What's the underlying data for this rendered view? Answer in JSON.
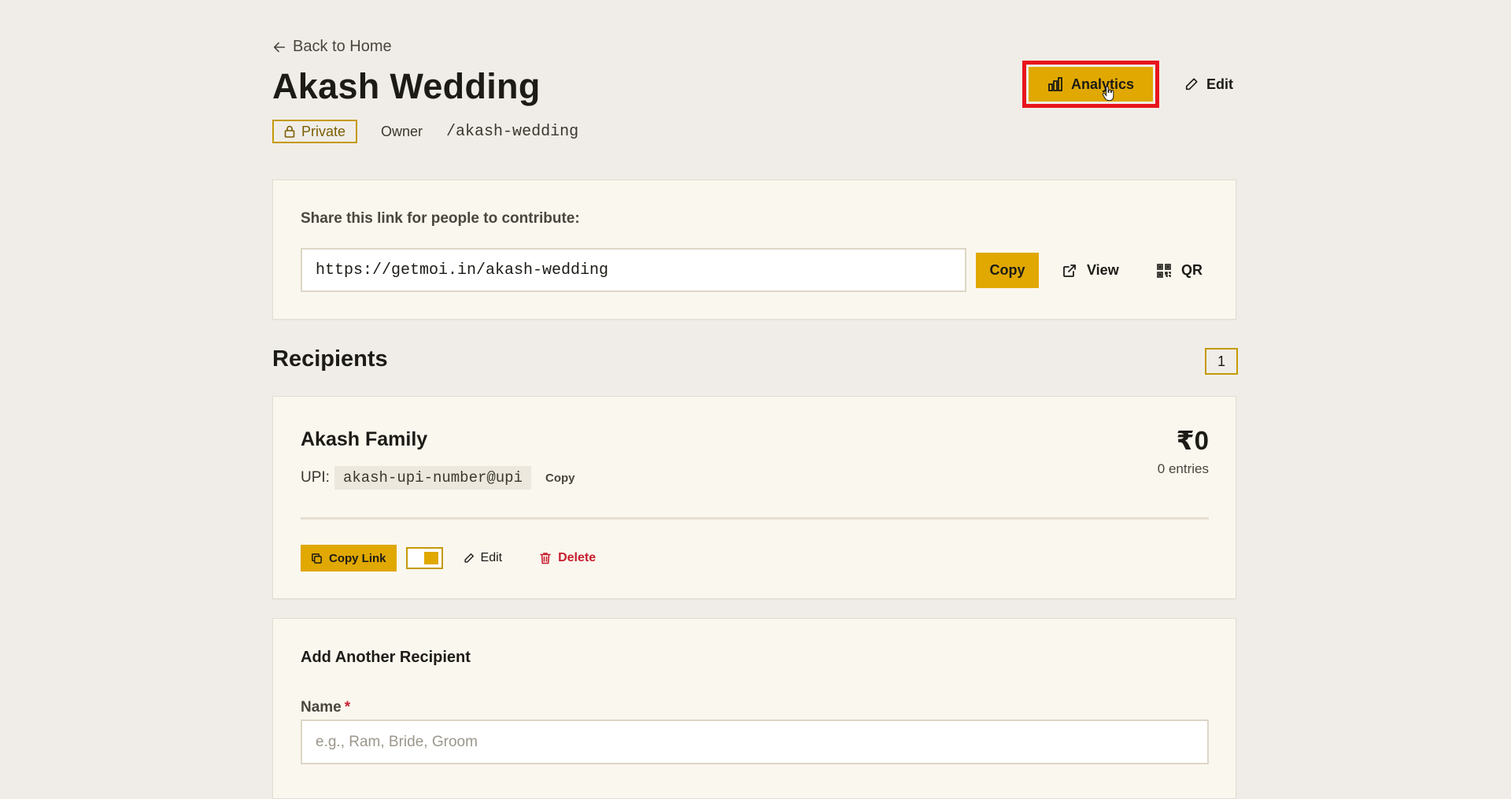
{
  "nav": {
    "back_label": "Back to Home"
  },
  "page": {
    "title": "Akash Wedding",
    "visibility_badge": "Private",
    "role": "Owner",
    "slug": "/akash-wedding"
  },
  "header_actions": {
    "analytics_label": "Analytics",
    "edit_label": "Edit"
  },
  "share": {
    "label": "Share this link for people to contribute:",
    "url": "https://getmoi.in/akash-wedding",
    "copy_label": "Copy",
    "view_label": "View",
    "qr_label": "QR"
  },
  "recipients": {
    "title": "Recipients",
    "count": "1",
    "items": [
      {
        "name": "Akash Family",
        "upi_label": "UPI:",
        "upi_value": "akash-upi-number@upi",
        "upi_copy_label": "Copy",
        "amount": "₹0",
        "entries": "0 entries",
        "copy_link_label": "Copy Link",
        "toggle_on": true,
        "edit_label": "Edit",
        "delete_label": "Delete"
      }
    ]
  },
  "add_recipient": {
    "title": "Add Another Recipient",
    "name_label": "Name",
    "required_marker": "*",
    "name_placeholder": "e.g., Ram, Bride, Groom"
  },
  "colors": {
    "accent": "#e0a800",
    "background": "#f0ede8",
    "card": "#faf7ef",
    "danger": "#c71f2d",
    "highlight_outline": "#e8141c"
  },
  "icons": {
    "back": "arrow-left-icon",
    "private": "lock-icon",
    "analytics": "bar-chart-icon",
    "edit": "pencil-icon",
    "view": "external-link-icon",
    "qr": "qr-code-icon",
    "copy_link": "copy-icon",
    "delete": "trash-icon",
    "cursor": "hand-pointer-icon"
  }
}
